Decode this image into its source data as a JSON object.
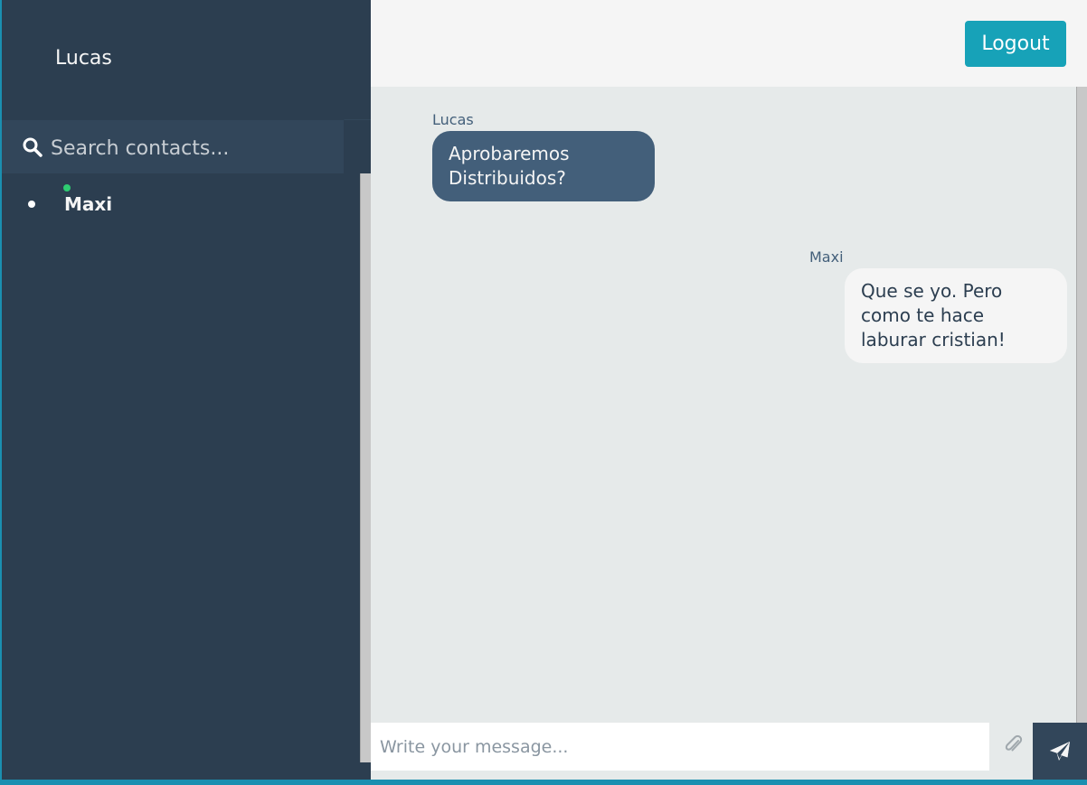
{
  "profile": {
    "name": "Lucas"
  },
  "search": {
    "placeholder": "Search contacts..."
  },
  "contacts": [
    {
      "name": "Maxi",
      "status": "online",
      "status_color": "#2ecc71"
    }
  ],
  "header": {
    "logout_label": "Logout"
  },
  "messages": [
    {
      "sender": "Lucas",
      "text": "Aprobaremos Distribuidos?",
      "direction": "sent"
    },
    {
      "sender": "Maxi",
      "text": "Que se yo. Pero como te hace laburar cristian!",
      "direction": "replies"
    }
  ],
  "composer": {
    "placeholder": "Write your message..."
  },
  "colors": {
    "sidebar_bg": "#2c3e50",
    "accent": "#17a2b8",
    "sent_bubble": "#435f7a",
    "reply_bubble": "#f5f5f5"
  },
  "icons": {
    "search": "search-icon",
    "attach": "paperclip-icon",
    "send": "paper-plane-icon"
  }
}
